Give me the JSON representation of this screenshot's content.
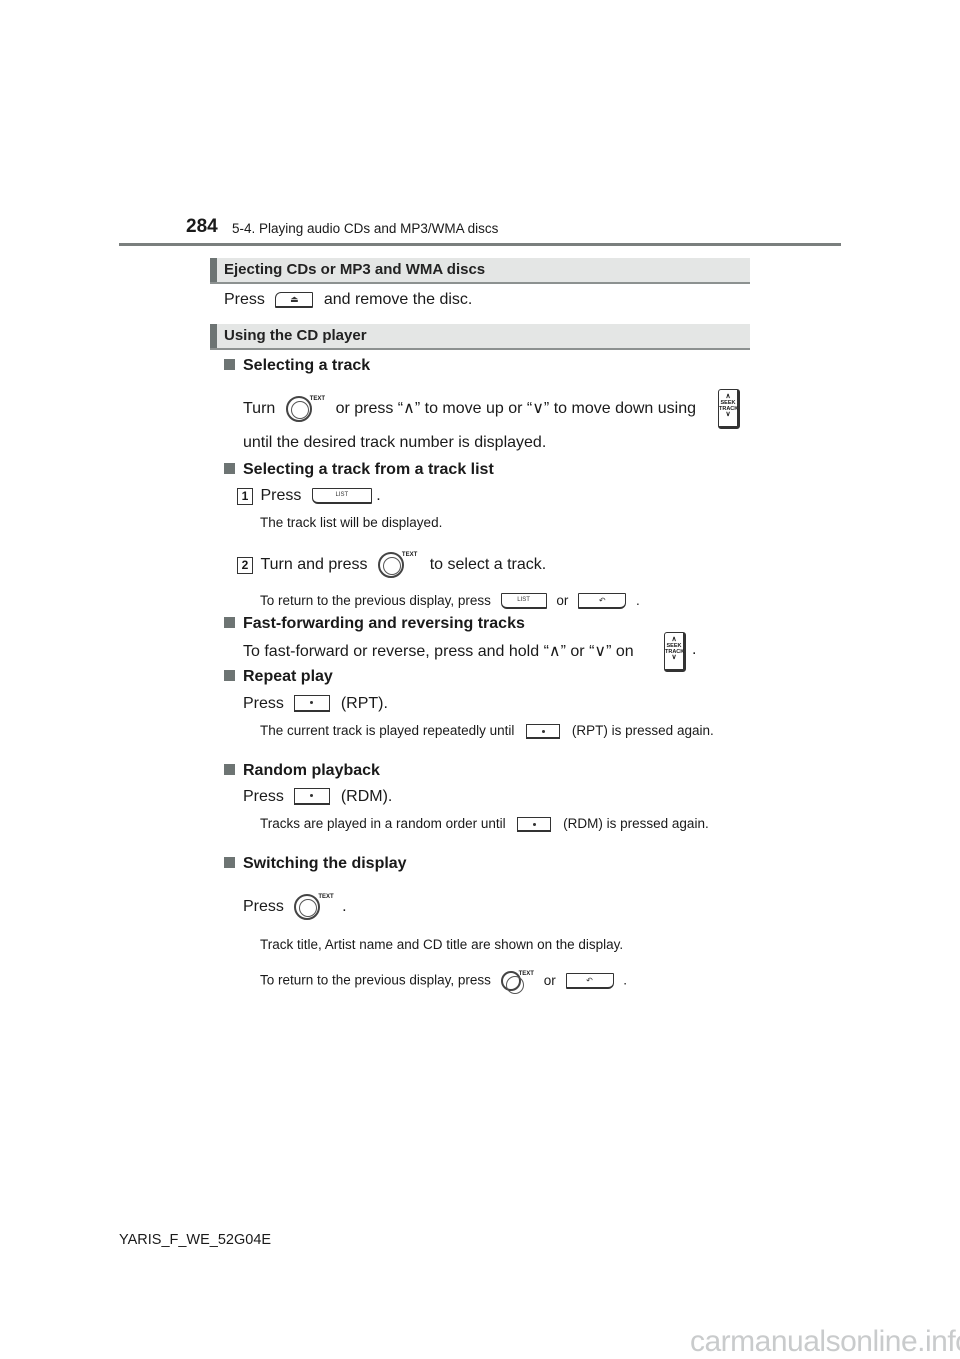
{
  "header": {
    "page_number": "284",
    "chapter": "5-4. Playing audio CDs and MP3/WMA discs"
  },
  "sections": [
    {
      "title": "Ejecting CDs or MP3 and WMA discs",
      "body": {
        "before": "Press",
        "after": "and remove the disc."
      }
    },
    {
      "title": "Using the CD player"
    }
  ],
  "selecting_track": {
    "title": "Selecting a track",
    "line1_a": "Turn",
    "line1_b": "or press “∧” to move up or “∨” to move down using",
    "line2": "until the desired track number is displayed."
  },
  "track_list": {
    "title": "Selecting a track from a track list",
    "step1_num": "1",
    "step1_a": "Press",
    "step1_b": ".",
    "step1_note": "The track list will be displayed.",
    "step2_num": "2",
    "step2_a": "Turn and press",
    "step2_b": "to select a track.",
    "return_a": "To return to the previous display, press",
    "return_or": "or",
    "return_end": "."
  },
  "fast_forward": {
    "title": "Fast-forwarding and reversing tracks",
    "text_a": "To fast-forward or reverse, press and hold “∧” or “∨” on",
    "text_b": "."
  },
  "repeat": {
    "title": "Repeat play",
    "press": "Press",
    "label": "(RPT).",
    "note_a": "The current track is played repeatedly until",
    "note_b": "(RPT) is pressed again."
  },
  "random": {
    "title": "Random playback",
    "press": "Press",
    "label": "(RDM).",
    "note_a": "Tracks are played in a random order until",
    "note_b": "(RDM) is pressed again."
  },
  "switch_display": {
    "title": "Switching the display",
    "press": "Press",
    "press_end": ".",
    "note": "Track title, Artist name and CD title are shown on the display.",
    "return_a": "To return to the previous display, press",
    "return_or": "or",
    "return_end": "."
  },
  "icons": {
    "knob_label": "TEXT",
    "list_label": "LIST",
    "seek_label_1": "SEEK",
    "seek_label_2": "TRACK",
    "eject_glyph": "⏏",
    "back_glyph": "↶",
    "up_glyph": "∧",
    "down_glyph": "∨"
  },
  "footer": {
    "doc_code": "YARIS_F_WE_52G04E",
    "watermark": "carmanualsonline.info"
  }
}
